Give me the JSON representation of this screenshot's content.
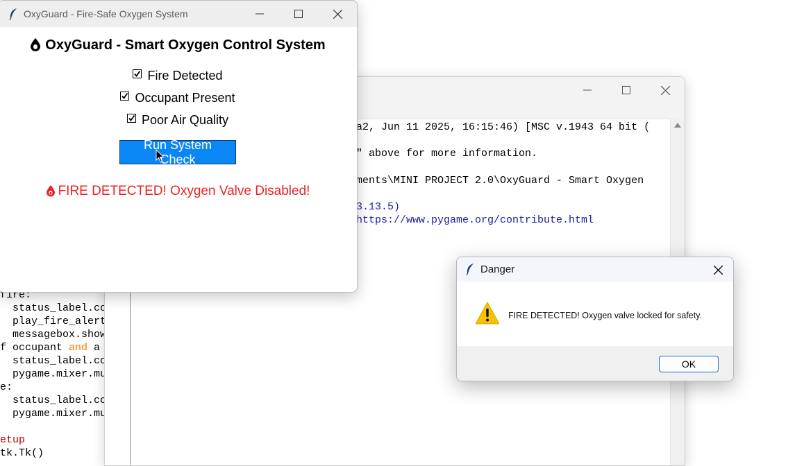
{
  "oxyguard_window": {
    "title": "OxyGuard - Fire-Safe Oxygen System",
    "heading": "OxyGuard - Smart Oxygen Control System",
    "checkboxes": [
      {
        "label": "Fire Detected",
        "checked": true
      },
      {
        "label": "Occupant Present",
        "checked": true
      },
      {
        "label": "Poor Air Quality",
        "checked": true
      }
    ],
    "run_button_label": "Run System Check",
    "status_text": "FIRE DETECTED! Oxygen Valve Disabled!",
    "status_color": "#ee2222",
    "button_color": "#0a86f5"
  },
  "shell_window": {
    "lines": [
      {
        "text": "a2, Jun 11 2025, 16:15:46) [MSC v.1943 64 bit (",
        "color": "black"
      },
      {
        "text": "\" above for more information.",
        "color": "black"
      },
      {
        "text": "ments\\MINI PROJECT 2.0\\OxyGuard - Smart Oxygen",
        "color": "black"
      },
      {
        "text": "3.13.5)",
        "color": "blue"
      },
      {
        "text": "https://www.pygame.org/contribute.html",
        "color": "blue"
      }
    ]
  },
  "code_snippet": {
    "lines": [
      "fire:",
      "  status_label.co",
      "  play_fire_alert",
      "  messagebox.show",
      "f occupant and a",
      "  status_label.co",
      "  pygame.mixer.mu",
      "e:",
      "  status_label.co",
      "  pygame.mixer.mu",
      "",
      "etup",
      "tk.Tk()"
    ]
  },
  "dialog": {
    "title": "Danger",
    "message": "FIRE DETECTED! Oxygen valve locked for safety.",
    "ok_label": "OK"
  }
}
